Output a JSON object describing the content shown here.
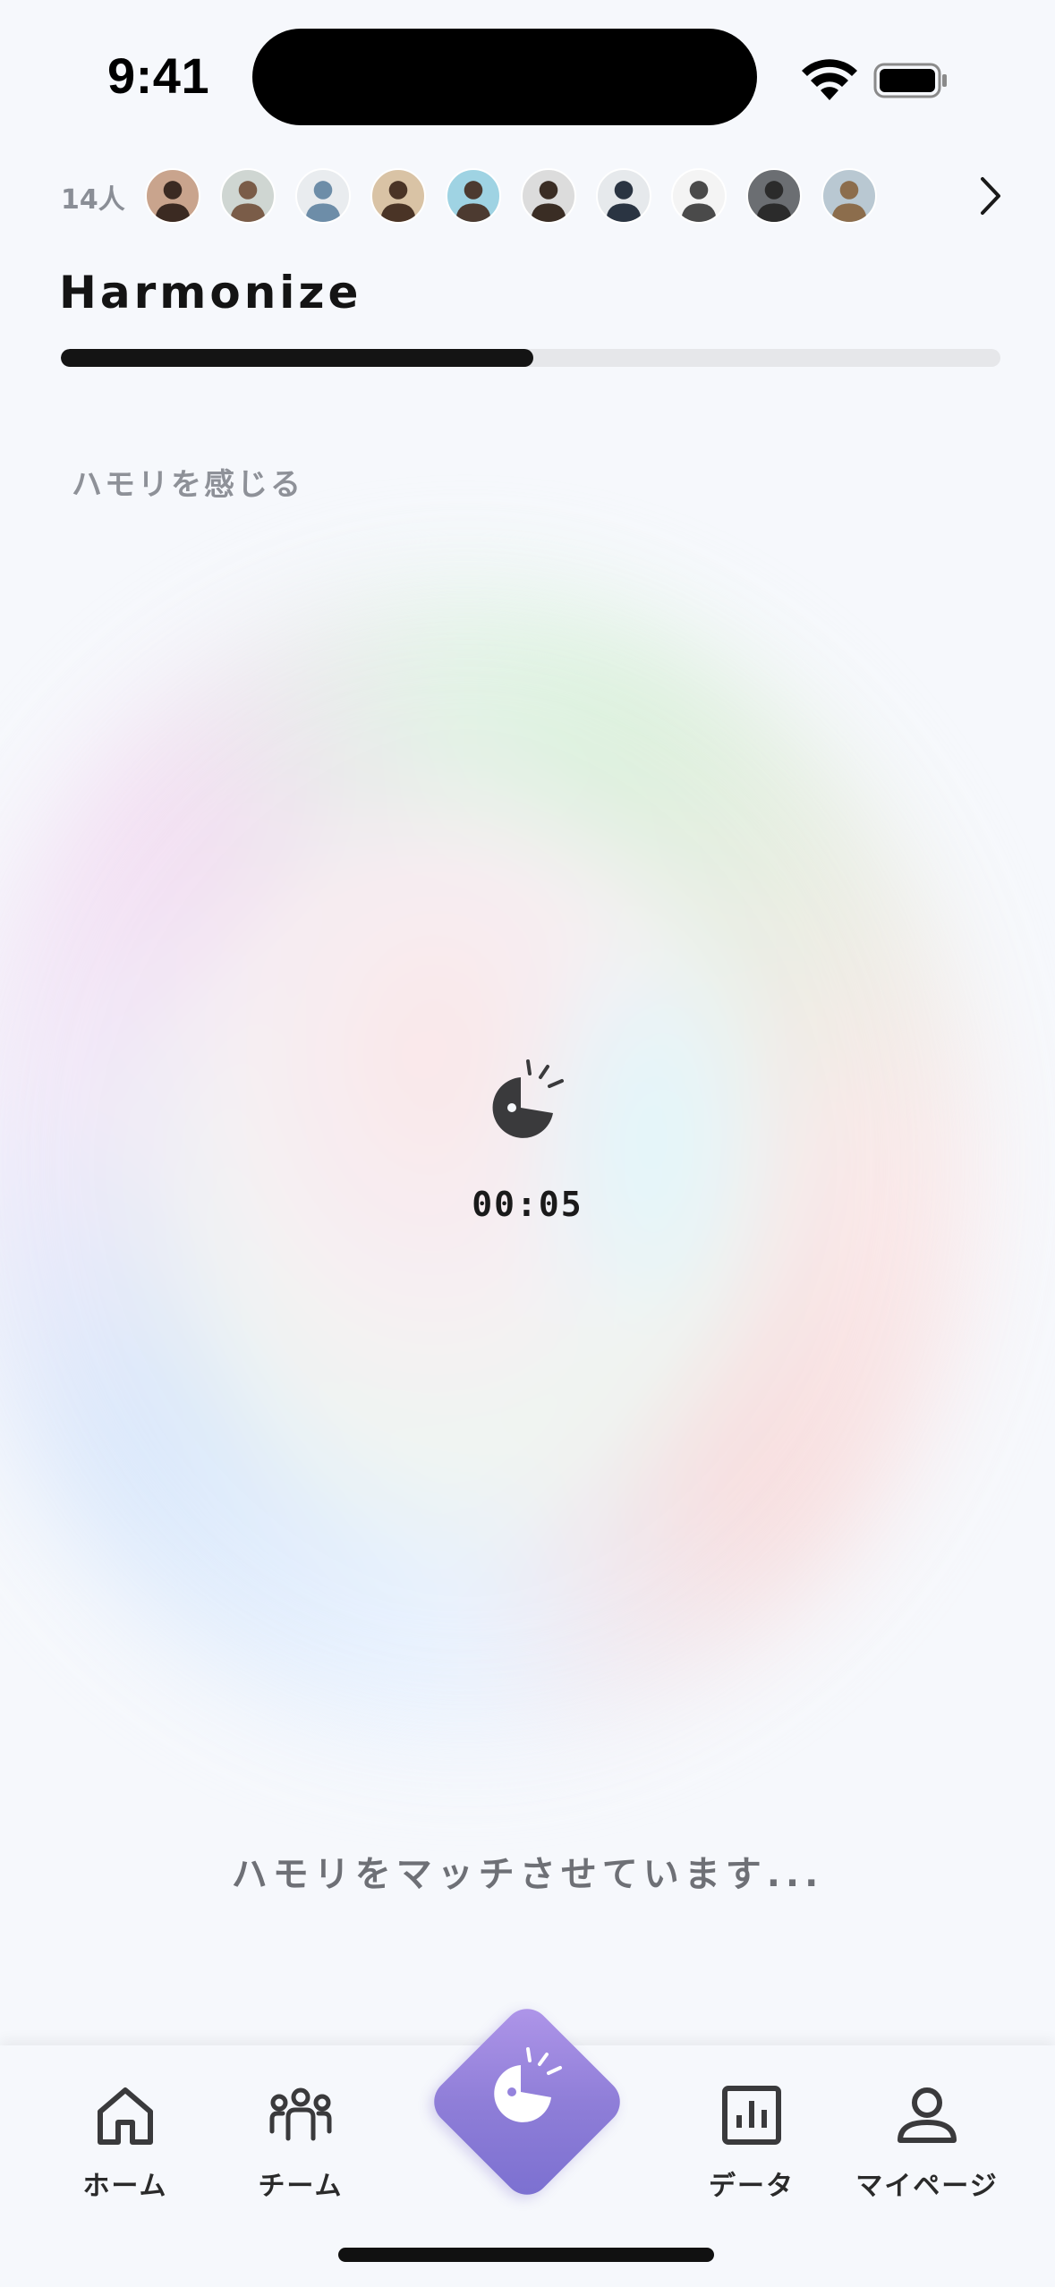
{
  "status_bar": {
    "time": "9:41"
  },
  "members": {
    "count_label": "14人",
    "avatars": [
      {
        "name": "avatar-1",
        "bg": "#c9a48d",
        "fg": "#3b2a22"
      },
      {
        "name": "avatar-2",
        "bg": "#cfd6d2",
        "fg": "#7a5c48"
      },
      {
        "name": "avatar-3",
        "bg": "#e9ecef",
        "fg": "#6d8da8"
      },
      {
        "name": "avatar-4",
        "bg": "#d9c3a5",
        "fg": "#4a3426"
      },
      {
        "name": "avatar-5",
        "bg": "#9fd3e3",
        "fg": "#4c3a30"
      },
      {
        "name": "avatar-6",
        "bg": "#dcdcdc",
        "fg": "#3a2d24"
      },
      {
        "name": "avatar-7",
        "bg": "#e6e9ec",
        "fg": "#2a3442"
      },
      {
        "name": "avatar-8",
        "bg": "#f4f4f4",
        "fg": "#4a4a4a"
      },
      {
        "name": "avatar-9",
        "bg": "#6b6e72",
        "fg": "#2b2b2b"
      },
      {
        "name": "avatar-10",
        "bg": "#b9c8d2",
        "fg": "#8c6d4c"
      }
    ]
  },
  "header": {
    "title": "Harmonize",
    "progress": 0.503
  },
  "section": {
    "label": "ハモリを感じる"
  },
  "timer": {
    "value": "00:05"
  },
  "status_message": "ハモリをマッチさせています...",
  "tabbar": {
    "home": "ホーム",
    "team": "チーム",
    "data": "データ",
    "mypage": "マイページ"
  },
  "colors": {
    "accent_start": "#b197ea",
    "accent_end": "#7a6fd0",
    "text_dark": "#141414",
    "muted": "#8a8e96"
  }
}
